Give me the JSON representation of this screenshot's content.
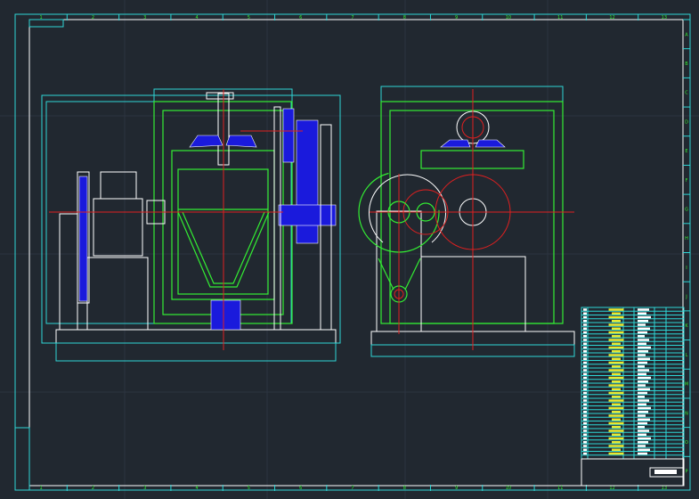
{
  "drawing": {
    "column_numbers": [
      "1",
      "2",
      "3",
      "4",
      "5",
      "6",
      "7",
      "8",
      "9",
      "10",
      "11",
      "12",
      "13"
    ],
    "row_letters": [
      "A",
      "B",
      "C",
      "D",
      "E",
      "F",
      "G",
      "H",
      "I",
      "J",
      "K",
      "L",
      "M",
      "N",
      "O",
      "P"
    ],
    "colors": {
      "background": "#212830",
      "frame": "#2ed6d6",
      "outline": "#ffffff",
      "structure": "#33ee33",
      "centerline": "#e02020",
      "part_fill": "#1a1adc"
    }
  }
}
